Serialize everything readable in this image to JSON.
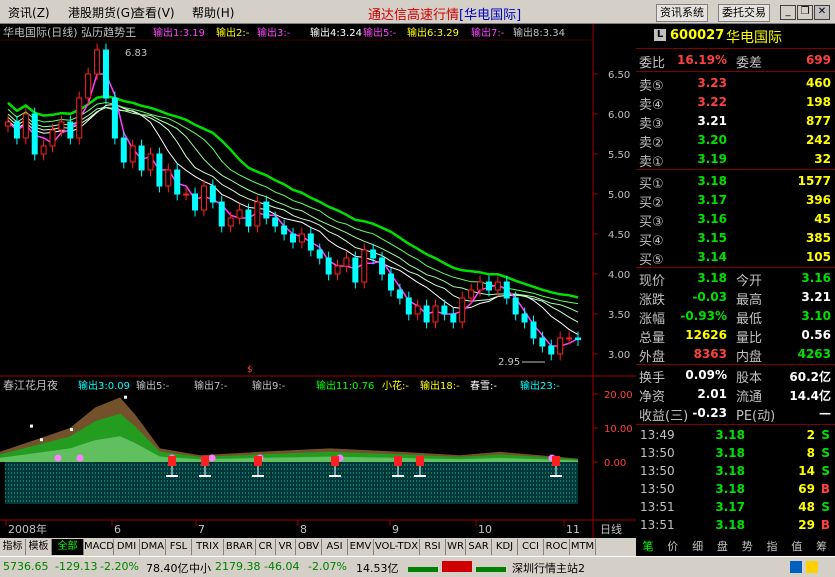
{
  "menu": [
    "资讯",
    "港股期货",
    "查看",
    "帮助"
  ],
  "menu_keys": [
    "(Z)",
    "(G)",
    "(V)",
    "(H)"
  ],
  "app_title": "通达信高速行情",
  "app_subtitle": "[华电国际]",
  "toolbar": {
    "news_system": "资讯系统",
    "trade": "委托交易"
  },
  "chart": {
    "title": "华电国际(日线) 弘历趋势王",
    "outputs": [
      "输出1:3.19",
      "输出2:-",
      "输出3:-",
      "输出4:3.24",
      "输出5:-",
      "输出6:3.29",
      "输出7:-",
      "输出8:3.34"
    ],
    "price_high": "6.83",
    "price_low": "2.95",
    "price_axis": [
      "6.50",
      "6.00",
      "5.50",
      "5.00",
      "4.50",
      "4.00",
      "3.50",
      "3.00"
    ],
    "indicator_title": "春江花月夜",
    "indicator_outputs": [
      "输出3:0.09",
      "输出5:-",
      "输出7:-",
      "输出9:-",
      "输出11:0.76"
    ],
    "indicator_extra": [
      "小花:-",
      "输出18:-",
      "春雪:-",
      "输出23:-"
    ],
    "indicator_axis": [
      "20.00",
      "10.00",
      "0.00"
    ],
    "date_axis": [
      "2008年",
      "6",
      "7",
      "8",
      "9",
      "10",
      "11"
    ],
    "period": "日线"
  },
  "chart_data": {
    "type": "candlestick",
    "title": "华电国际(日线) 弘历趋势王",
    "ylim": [
      2.8,
      6.9
    ],
    "close": [
      5.9,
      5.7,
      6.0,
      5.5,
      5.6,
      5.8,
      5.9,
      5.7,
      6.2,
      6.5,
      6.8,
      6.2,
      5.7,
      5.4,
      5.6,
      5.3,
      5.5,
      5.1,
      5.3,
      5.0,
      5.0,
      4.8,
      5.1,
      4.9,
      4.6,
      4.7,
      4.8,
      4.6,
      4.9,
      4.7,
      4.6,
      4.5,
      4.4,
      4.5,
      4.3,
      4.2,
      4.0,
      4.1,
      4.2,
      3.9,
      4.3,
      4.2,
      4.0,
      3.8,
      3.7,
      3.5,
      3.6,
      3.4,
      3.6,
      3.5,
      3.4,
      3.7,
      3.8,
      3.9,
      3.8,
      3.9,
      3.7,
      3.5,
      3.4,
      3.2,
      3.1,
      3.0,
      3.2,
      3.2,
      3.18
    ],
    "ma_bands": [
      {
        "name": "输出1",
        "last": 3.19
      },
      {
        "name": "输出4",
        "last": 3.24
      },
      {
        "name": "输出6",
        "last": 3.29
      },
      {
        "name": "输出8",
        "last": 3.34
      }
    ]
  },
  "stock": {
    "code": "600027",
    "name": "华电国际",
    "badge": "L"
  },
  "order_ratio": {
    "label": "委比",
    "value": "16.19%",
    "label2": "委差",
    "value2": "699"
  },
  "sells": [
    {
      "label": "卖⑤",
      "price": "3.23",
      "vol": "460",
      "color": "#ff4040"
    },
    {
      "label": "卖④",
      "price": "3.22",
      "vol": "198",
      "color": "#ff4040"
    },
    {
      "label": "卖③",
      "price": "3.21",
      "vol": "877",
      "color": "#ffffff"
    },
    {
      "label": "卖②",
      "price": "3.20",
      "vol": "242",
      "color": "#00e000"
    },
    {
      "label": "卖①",
      "price": "3.19",
      "vol": "32",
      "color": "#00e000"
    }
  ],
  "buys": [
    {
      "label": "买①",
      "price": "3.18",
      "vol": "1577"
    },
    {
      "label": "买②",
      "price": "3.17",
      "vol": "396"
    },
    {
      "label": "买③",
      "price": "3.16",
      "vol": "45"
    },
    {
      "label": "买④",
      "price": "3.15",
      "vol": "385"
    },
    {
      "label": "买⑤",
      "price": "3.14",
      "vol": "105"
    }
  ],
  "stats": [
    {
      "l": "现价",
      "v": "3.18",
      "c": "#00e000",
      "l2": "今开",
      "v2": "3.16",
      "c2": "#00e000"
    },
    {
      "l": "涨跌",
      "v": "-0.03",
      "c": "#00e000",
      "l2": "最高",
      "v2": "3.21",
      "c2": "#ffffff"
    },
    {
      "l": "涨幅",
      "v": "-0.93%",
      "c": "#00e000",
      "l2": "最低",
      "v2": "3.10",
      "c2": "#00e000"
    },
    {
      "l": "总量",
      "v": "12626",
      "c": "#ffff00",
      "l2": "量比",
      "v2": "0.56",
      "c2": "#ffffff"
    },
    {
      "l": "外盘",
      "v": "8363",
      "c": "#ff4040",
      "l2": "内盘",
      "v2": "4263",
      "c2": "#00e000"
    }
  ],
  "fund": [
    {
      "l": "换手",
      "v": "0.09%",
      "l2": "股本",
      "v2": "60.2亿"
    },
    {
      "l": "净资",
      "v": "2.01",
      "l2": "流通",
      "v2": "14.4亿"
    },
    {
      "l": "收益(三)",
      "v": "-0.23",
      "l2": "PE(动)",
      "v2": "—"
    }
  ],
  "ticks": [
    {
      "t": "13:49",
      "p": "3.18",
      "v": "2",
      "d": "S"
    },
    {
      "t": "13:50",
      "p": "3.18",
      "v": "8",
      "d": "S"
    },
    {
      "t": "13:50",
      "p": "3.18",
      "v": "14",
      "d": "S"
    },
    {
      "t": "13:50",
      "p": "3.18",
      "v": "69",
      "d": "B"
    },
    {
      "t": "13:51",
      "p": "3.17",
      "v": "48",
      "d": "S"
    },
    {
      "t": "13:51",
      "p": "3.18",
      "v": "29",
      "d": "B"
    }
  ],
  "tabs": [
    "指标",
    "模板",
    "全部",
    "MACD",
    "DMI",
    "DMA",
    "FSL",
    "TRIX",
    "BRAR",
    "CR",
    "VR",
    "OBV",
    "ASI",
    "EMV",
    "VOL-TDX",
    "RSI",
    "WR",
    "SAR",
    "KDJ",
    "CCI",
    "ROC",
    "MTM"
  ],
  "right_tabs": [
    "笔",
    "价",
    "细",
    "盘",
    "势",
    "指",
    "值",
    "筹"
  ],
  "status": {
    "index": "5736.65",
    "chg": "-129.13",
    "pct": "-2.20%",
    "amt": "78.40亿",
    "idx2_name": "中小",
    "idx2": "2179.38",
    "chg2": "-46.04",
    "pct2": "-2.07%",
    "amt2": "14.53亿",
    "server": "深圳行情主站2"
  }
}
